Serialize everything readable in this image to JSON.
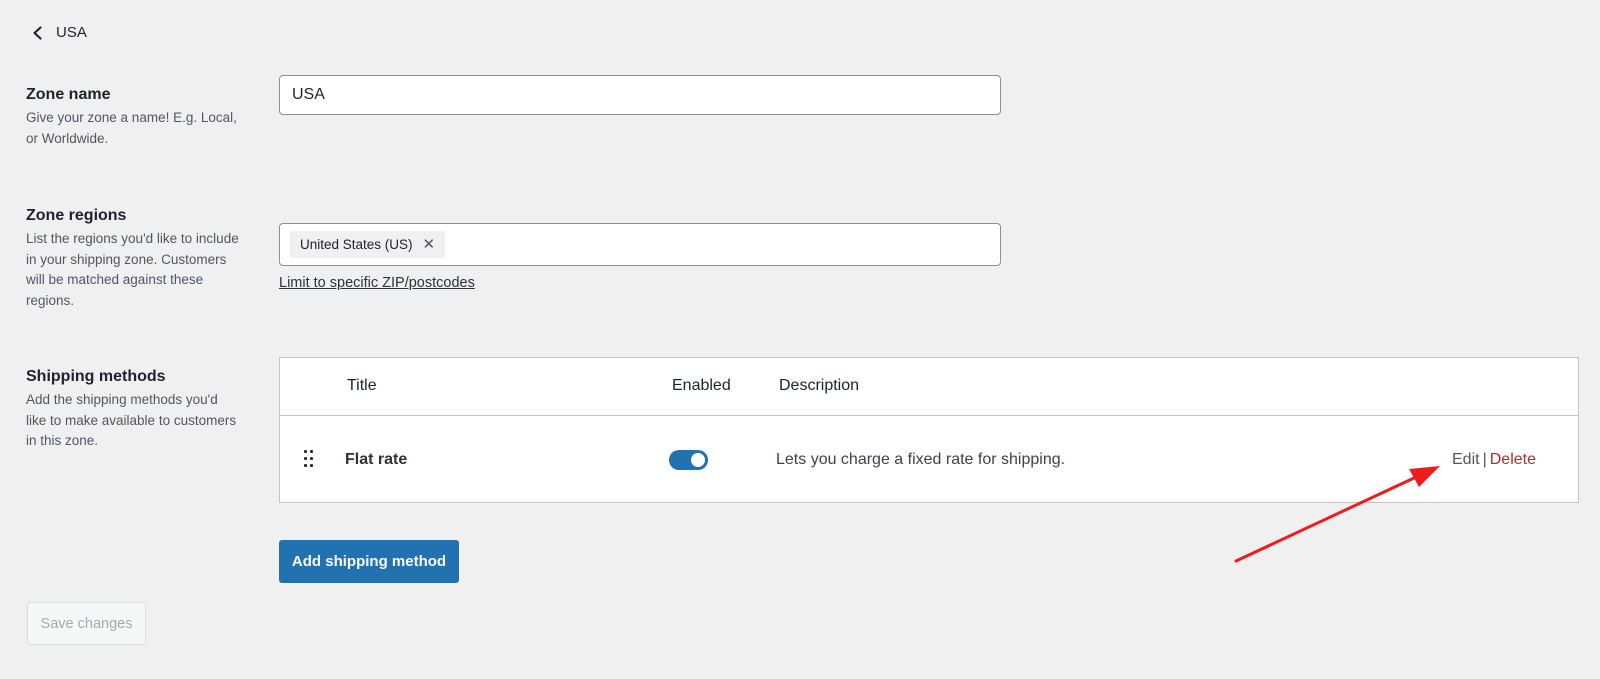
{
  "header": {
    "back_label": "USA"
  },
  "zone_name": {
    "title": "Zone name",
    "description": "Give your zone a name! E.g. Local, or Worldwide.",
    "value": "USA"
  },
  "zone_regions": {
    "title": "Zone regions",
    "description": "List the regions you'd like to include in your shipping zone. Customers will be matched against these regions.",
    "chips": [
      {
        "label": "United States (US)",
        "remove": "✕"
      }
    ],
    "limit_link": "Limit to specific ZIP/postcodes"
  },
  "shipping_methods": {
    "title": "Shipping methods",
    "description": "Add the shipping methods you'd like to make available to customers in this zone.",
    "columns": {
      "title": "Title",
      "enabled": "Enabled",
      "description": "Description"
    },
    "rows": [
      {
        "title": "Flat rate",
        "enabled": true,
        "description": "Lets you charge a fixed rate for shipping.",
        "edit_label": "Edit",
        "separator": "|",
        "delete_label": "Delete"
      }
    ],
    "add_button": "Add shipping method"
  },
  "footer": {
    "save_button": "Save changes"
  },
  "colors": {
    "accent": "#2271b1",
    "delete": "#b32d2e",
    "annotation_arrow": "#ee1c1c"
  },
  "icons": {
    "back": "chevron-left-icon",
    "drag": "drag-handle-icon",
    "remove": "close-icon"
  }
}
